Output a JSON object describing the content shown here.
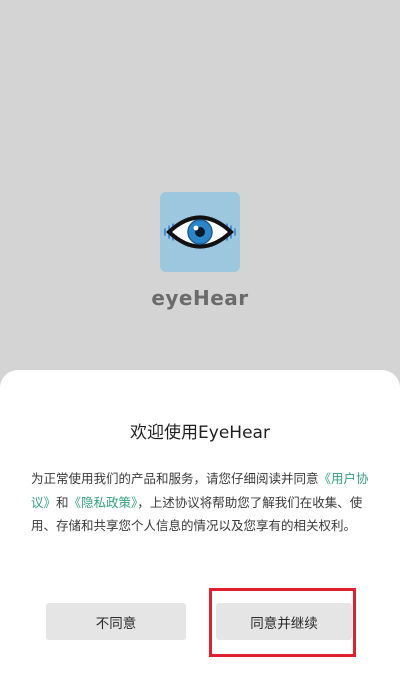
{
  "app": {
    "name": "eyeHear",
    "icon": "eye-with-sound-waves-icon",
    "icon_bg": "#9cc7de"
  },
  "dialog": {
    "title": "欢迎使用EyeHear",
    "body_part1": "为正常使用我们的产品和服务，请您仔细阅读并同意",
    "user_agreement_link": "《用户协议》",
    "conjunction": "和",
    "privacy_policy_link": "《隐私政策》",
    "body_part2": "，上述协议将帮助您了解我们在收集、使用、存储和共享您个人信息的情况以及您享有的相关权利。",
    "disagree_label": "不同意",
    "agree_label": "同意并继续",
    "link_color": "#35a27a",
    "highlight_color": "#e0202f"
  }
}
